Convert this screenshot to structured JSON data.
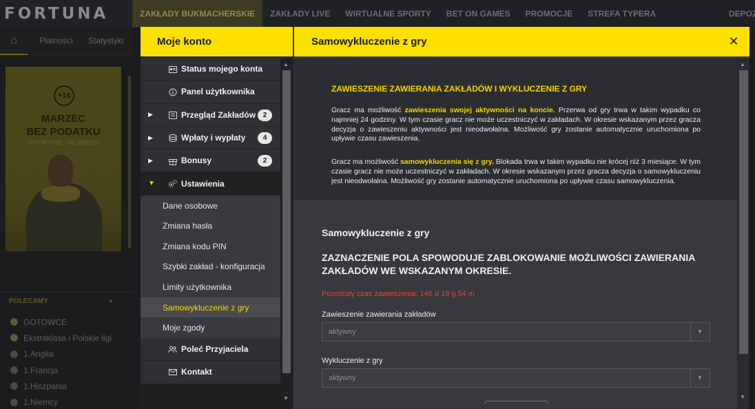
{
  "brand": {
    "logo": "FORTUNA"
  },
  "top_nav": {
    "items": [
      "ZAKŁADY BUKMACHERSKIE",
      "ZAKŁADY LIVE",
      "WIRTUALNE SPORTY",
      "BET ON GAMES",
      "PROMOCJE",
      "STREFA TYPERA"
    ],
    "cut_item": "DEPOZY"
  },
  "sub_nav": {
    "tabs": [
      "Płatności",
      "Statystyki"
    ]
  },
  "banner": {
    "age": "+18",
    "title_line1": "MARZEC",
    "title_line2": "BEZ PODATKU",
    "subtitle": "W FORTUNIE I NIE WIĘCEJ"
  },
  "polecamy": {
    "title": "POLECAMY",
    "items": [
      "GOTOWCE",
      "Ekstraklasa i Polskie ligi",
      "1.Anglia",
      "1.Francja",
      "1.Hiszpania",
      "1.Niemcy"
    ]
  },
  "account_menu": {
    "title": "Moje konto",
    "items": [
      {
        "label": "Status mojego konta",
        "icon": "id-card-icon"
      },
      {
        "label": "Panel użytkownika",
        "icon": "info-icon"
      },
      {
        "label": "Przegląd Zakładów",
        "icon": "ticket-icon",
        "badge": "2"
      },
      {
        "label": "Wpłaty i wypłaty",
        "icon": "coins-icon",
        "badge": "4"
      },
      {
        "label": "Bonusy",
        "icon": "gift-icon",
        "badge": "2"
      },
      {
        "label": "Ustawienia",
        "icon": "gears-icon"
      }
    ],
    "settings_subitems": [
      "Dane osobowe",
      "Zmiana hasła",
      "Zmiana kodu PIN",
      "Szybki zakład - konfiguracja",
      "Limity użytkownika",
      "Samowykluczenie z gry",
      "Moje zgody"
    ],
    "bottom_items": [
      {
        "label": "Poleć Przyjaciela",
        "icon": "users-icon"
      },
      {
        "label": "Kontakt",
        "icon": "envelope-icon"
      }
    ]
  },
  "content": {
    "header_title": "Samowykluczenie z gry",
    "info": {
      "title": "ZAWIESZENIE ZAWIERANIA ZAKŁADÓW I WYKLUCZENIE Z GRY",
      "p1_before": "Gracz ma możliwość ",
      "p1_highlight": "zawieszenia swojej aktywności na koncie.",
      "p1_after": " Przerwa od gry trwa w takim wypadku co najmniej 24 godziny. W tym czasie gracz nie może uczestniczyć w zakładach. W okresie wskazanym przez gracza decyzja o zawieszeniu aktywności jest nieodwołalna. Możliwość gry zostanie automatycznie uruchomiona po upływie czasu zawieszenia.",
      "p2_before": "Gracz ma możliwość ",
      "p2_highlight": "samowykluczenia się z gry.",
      "p2_after": " Blokada trwa w takim wypadku nie krócej niż 3 miesiące. W tym czasie gracz nie może uczestniczyć w zakładach. W okresie wskazanym przez gracza decyzja o samowykluczeniu jest nieodwołalna. Możliwość gry zostanie automatycznie uruchomiona po upływie czasu samowykluczenia."
    },
    "section_title": "Samowykluczenie z gry",
    "warning": "ZAZNACZENIE POLA SPOWODUJE ZABLOKOWANIE MOŻLIWOŚCI ZAWIERANIA ZAKŁADÓW WE WSKAZANYM OKRESIE.",
    "remaining_time": "Pozostały czas zawieszenia: 146 d 19 g 54 m",
    "fields": [
      {
        "label": "Zawieszenie zawierania zakładów",
        "value": "aktywny"
      },
      {
        "label": "Wykluczenie z gry",
        "value": "aktywny"
      }
    ]
  },
  "colors": {
    "accent": "#fbe000",
    "highlight": "#f5d300",
    "alert": "#e2433a",
    "panel": "#38393c"
  }
}
